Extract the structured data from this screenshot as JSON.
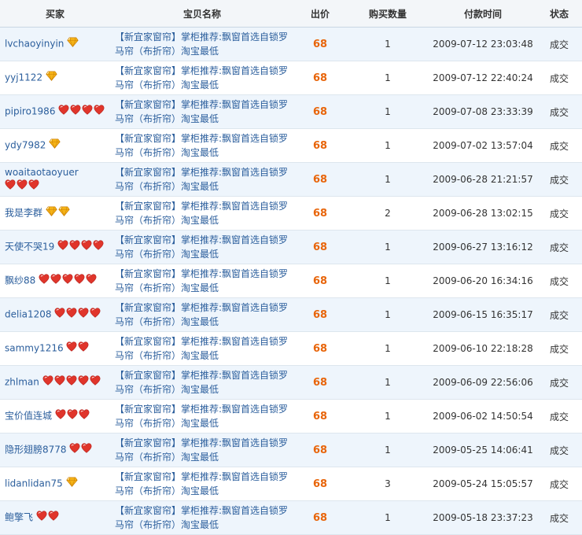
{
  "columns": {
    "buyer": "买家",
    "item": "宝贝名称",
    "price": "出价",
    "qty": "购买数量",
    "time": "付款时间",
    "status": "状态"
  },
  "colors": {
    "heart": "#e0352b",
    "heart_dark": "#b31f1a",
    "diamond": "#f5b317",
    "diamond_dark": "#c97c00",
    "price": "#e8650a",
    "link": "#2b5e9c"
  },
  "rows": [
    {
      "buyer": "lvchaoyinyin",
      "badge": {
        "type": "diamond",
        "count": 1
      },
      "item": "【新宜家窗帘】掌柜推荐:飘窗首选自锁罗马帘（布折帘）淘宝最低",
      "price": "68",
      "qty": "1",
      "time": "2009-07-12 23:03:48",
      "status": "成交"
    },
    {
      "buyer": "yyj1122",
      "badge": {
        "type": "diamond",
        "count": 1
      },
      "item": "【新宜家窗帘】掌柜推荐:飘窗首选自锁罗马帘（布折帘）淘宝最低",
      "price": "68",
      "qty": "1",
      "time": "2009-07-12 22:40:24",
      "status": "成交"
    },
    {
      "buyer": "pipiro1986",
      "badge": {
        "type": "heart",
        "count": 4
      },
      "item": "【新宜家窗帘】掌柜推荐:飘窗首选自锁罗马帘（布折帘）淘宝最低",
      "price": "68",
      "qty": "1",
      "time": "2009-07-08 23:33:39",
      "status": "成交"
    },
    {
      "buyer": "ydy7982",
      "badge": {
        "type": "diamond",
        "count": 1
      },
      "item": "【新宜家窗帘】掌柜推荐:飘窗首选自锁罗马帘（布折帘）淘宝最低",
      "price": "68",
      "qty": "1",
      "time": "2009-07-02 13:57:04",
      "status": "成交"
    },
    {
      "buyer": "woaitaotaoyuer",
      "badge": {
        "type": "heart",
        "count": 3
      },
      "item": "【新宜家窗帘】掌柜推荐:飘窗首选自锁罗马帘（布折帘）淘宝最低",
      "price": "68",
      "qty": "1",
      "time": "2009-06-28 21:21:57",
      "status": "成交"
    },
    {
      "buyer": "我是李群",
      "badge": {
        "type": "diamond",
        "count": 2
      },
      "item": "【新宜家窗帘】掌柜推荐:飘窗首选自锁罗马帘（布折帘）淘宝最低",
      "price": "68",
      "qty": "2",
      "time": "2009-06-28 13:02:15",
      "status": "成交"
    },
    {
      "buyer": "天使不哭19",
      "badge": {
        "type": "heart",
        "count": 4
      },
      "item": "【新宜家窗帘】掌柜推荐:飘窗首选自锁罗马帘（布折帘）淘宝最低",
      "price": "68",
      "qty": "1",
      "time": "2009-06-27 13:16:12",
      "status": "成交"
    },
    {
      "buyer": "飘纱88",
      "badge": {
        "type": "heart",
        "count": 5
      },
      "item": "【新宜家窗帘】掌柜推荐:飘窗首选自锁罗马帘（布折帘）淘宝最低",
      "price": "68",
      "qty": "1",
      "time": "2009-06-20 16:34:16",
      "status": "成交"
    },
    {
      "buyer": "delia1208",
      "badge": {
        "type": "heart",
        "count": 4
      },
      "item": "【新宜家窗帘】掌柜推荐:飘窗首选自锁罗马帘（布折帘）淘宝最低",
      "price": "68",
      "qty": "1",
      "time": "2009-06-15 16:35:17",
      "status": "成交"
    },
    {
      "buyer": "sammy1216",
      "badge": {
        "type": "heart",
        "count": 2
      },
      "item": "【新宜家窗帘】掌柜推荐:飘窗首选自锁罗马帘（布折帘）淘宝最低",
      "price": "68",
      "qty": "1",
      "time": "2009-06-10 22:18:28",
      "status": "成交"
    },
    {
      "buyer": "zhlman",
      "badge": {
        "type": "heart",
        "count": 5
      },
      "item": "【新宜家窗帘】掌柜推荐:飘窗首选自锁罗马帘（布折帘）淘宝最低",
      "price": "68",
      "qty": "1",
      "time": "2009-06-09 22:56:06",
      "status": "成交"
    },
    {
      "buyer": "宝价值连城",
      "badge": {
        "type": "heart",
        "count": 3
      },
      "item": "【新宜家窗帘】掌柜推荐:飘窗首选自锁罗马帘（布折帘）淘宝最低",
      "price": "68",
      "qty": "1",
      "time": "2009-06-02 14:50:54",
      "status": "成交"
    },
    {
      "buyer": "隐形翅膀8778",
      "badge": {
        "type": "heart",
        "count": 2
      },
      "item": "【新宜家窗帘】掌柜推荐:飘窗首选自锁罗马帘（布折帘）淘宝最低",
      "price": "68",
      "qty": "1",
      "time": "2009-05-25 14:06:41",
      "status": "成交"
    },
    {
      "buyer": "lidanlidan75",
      "badge": {
        "type": "diamond",
        "count": 1
      },
      "item": "【新宜家窗帘】掌柜推荐:飘窗首选自锁罗马帘（布折帘）淘宝最低",
      "price": "68",
      "qty": "3",
      "time": "2009-05-24 15:05:57",
      "status": "成交"
    },
    {
      "buyer": "鲍擎飞",
      "badge": {
        "type": "heart",
        "count": 2
      },
      "item": "【新宜家窗帘】掌柜推荐:飘窗首选自锁罗马帘（布折帘）淘宝最低",
      "price": "68",
      "qty": "1",
      "time": "2009-05-18 23:37:23",
      "status": "成交"
    }
  ]
}
